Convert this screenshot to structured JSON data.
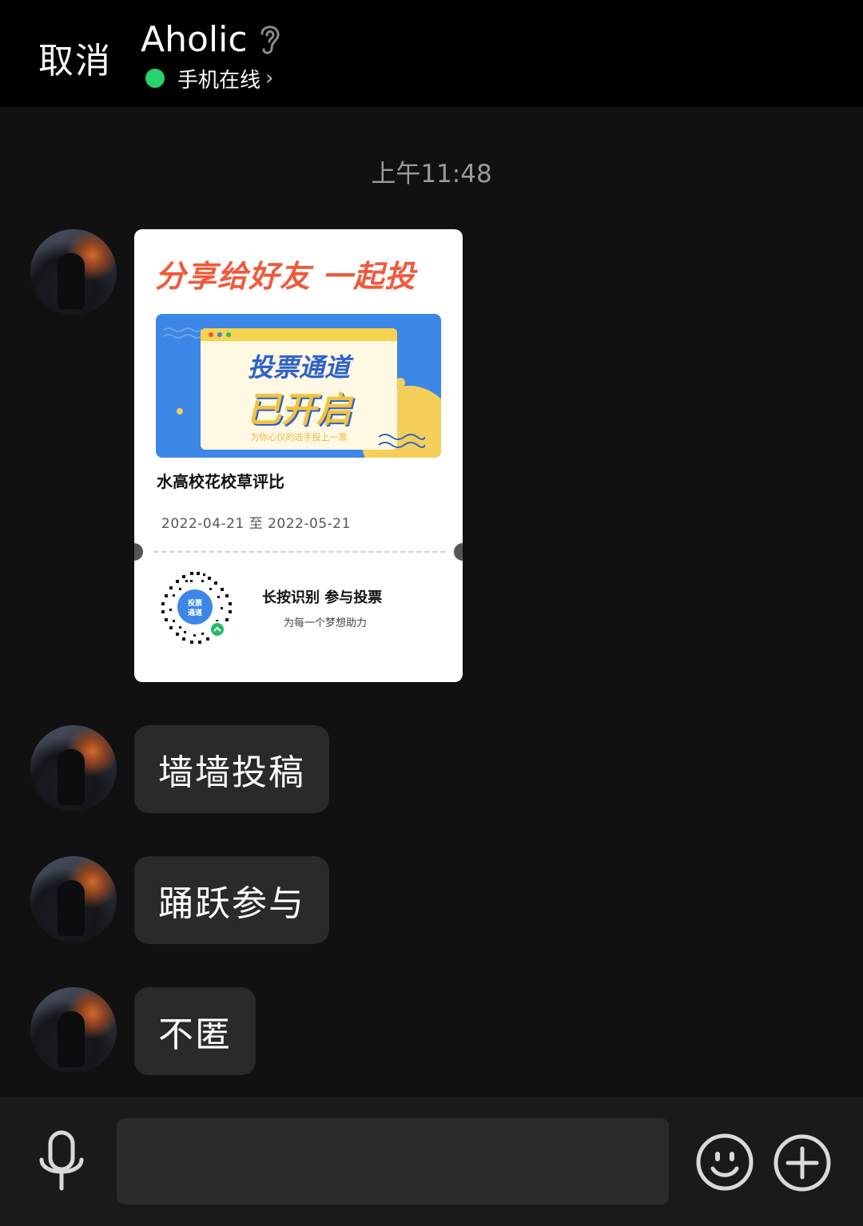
{
  "header": {
    "cancel_label": "取消",
    "contact_name": "Aholic",
    "status_text": "手机在线",
    "status_chevron": "›",
    "status_color": "#27d36a",
    "earpiece_icon": "ear-icon"
  },
  "chat": {
    "timestamp": "上午11:48",
    "share_card": {
      "headline": "分享给好友 一起投",
      "banner_line_1": "投票通道",
      "banner_line_2": "已开启",
      "banner_sub": "为你心仪的选手投上一票",
      "title": "水高校花校草评比",
      "date_range": "2022-04-21 至 2022-05-21",
      "qr_center_text": "投票\n通道",
      "cta": "长按识别  参与投票",
      "cta_sub": "为每一个梦想助力",
      "accent_color": "#ef5a3c",
      "banner_color": "#3c86e6"
    },
    "messages": [
      {
        "text": "墙墙投稿"
      },
      {
        "text": "踊跃参与"
      },
      {
        "text": "不匿"
      }
    ]
  },
  "input_bar": {
    "input_value": "",
    "mic_icon": "microphone-icon",
    "emoji_icon": "smiley-icon",
    "plus_icon": "plus-circle-icon"
  }
}
